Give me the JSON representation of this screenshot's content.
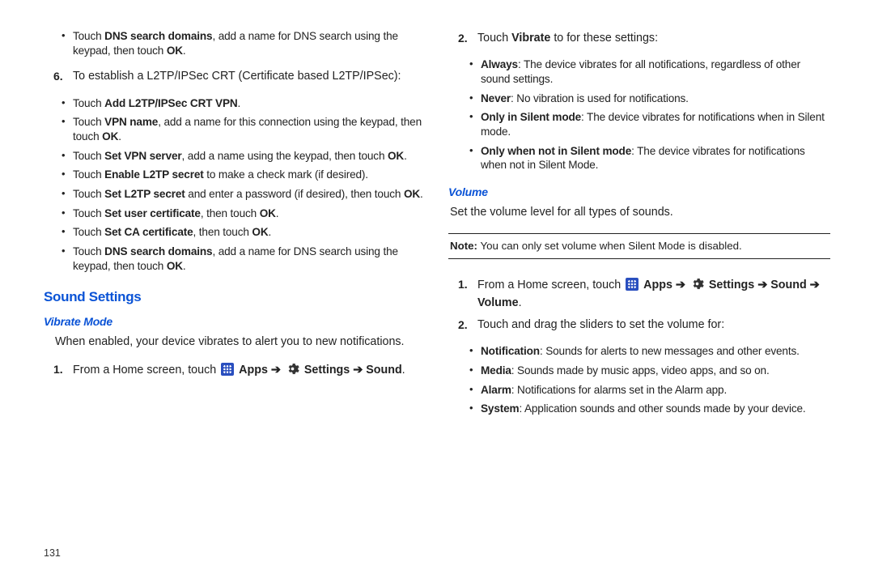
{
  "left": {
    "top_bullets": [
      {
        "parts": [
          "Touch ",
          [
            "b",
            "DNS search domains"
          ],
          ", add a name for DNS search using the keypad, then touch ",
          [
            "b",
            "OK"
          ],
          "."
        ]
      }
    ],
    "step6_label": "6.",
    "step6_text": "To establish a L2TP/IPSec CRT (Certificate based L2TP/IPSec):",
    "step6_bullets": [
      {
        "parts": [
          "Touch ",
          [
            "b",
            "Add L2TP/IPSec CRT VPN"
          ],
          "."
        ]
      },
      {
        "parts": [
          "Touch ",
          [
            "b",
            "VPN name"
          ],
          ", add a name for this connection using the keypad, then touch ",
          [
            "b",
            "OK"
          ],
          "."
        ]
      },
      {
        "parts": [
          "Touch ",
          [
            "b",
            "Set VPN server"
          ],
          ", add a name using the keypad, then touch ",
          [
            "b",
            "OK"
          ],
          "."
        ]
      },
      {
        "parts": [
          "Touch ",
          [
            "b",
            "Enable L2TP secret"
          ],
          " to make a check mark (if desired)."
        ]
      },
      {
        "parts": [
          "Touch ",
          [
            "b",
            "Set L2TP secret"
          ],
          " and enter a password (if desired), then touch ",
          [
            "b",
            "OK"
          ],
          "."
        ]
      },
      {
        "parts": [
          "Touch ",
          [
            "b",
            "Set user certificate"
          ],
          ", then touch ",
          [
            "b",
            "OK"
          ],
          "."
        ]
      },
      {
        "parts": [
          "Touch ",
          [
            "b",
            "Set CA certificate"
          ],
          ", then touch ",
          [
            "b",
            "OK"
          ],
          "."
        ]
      },
      {
        "parts": [
          "Touch ",
          [
            "b",
            "DNS search domains"
          ],
          ", add a name for DNS search using the keypad, then touch ",
          [
            "b",
            "OK"
          ],
          "."
        ]
      }
    ],
    "section_title": "Sound Settings",
    "sub_title": "Vibrate Mode",
    "vibrate_intro": "When enabled, your device vibrates to alert you to new notifications.",
    "step1_label": "1.",
    "step1_parts": [
      "From a Home screen, touch ",
      [
        "icon",
        "apps"
      ],
      " ",
      [
        "b",
        "Apps"
      ],
      " ",
      [
        "arrow",
        "➔"
      ],
      " ",
      [
        "icon",
        "settings"
      ],
      " ",
      [
        "b",
        "Settings"
      ],
      " ",
      [
        "arrow",
        "➔"
      ],
      " ",
      [
        "b",
        "Sound"
      ],
      "."
    ],
    "page_number": "131"
  },
  "right": {
    "step2_label": "2.",
    "step2_parts": [
      "Touch ",
      [
        "b",
        "Vibrate"
      ],
      " to for these settings:"
    ],
    "step2_bullets": [
      {
        "parts": [
          [
            "b",
            "Always"
          ],
          ": The device vibrates for all notifications, regardless of other sound settings."
        ]
      },
      {
        "parts": [
          [
            "b",
            "Never"
          ],
          ": No vibration is used for notifications."
        ]
      },
      {
        "parts": [
          [
            "b",
            "Only in Silent mode"
          ],
          ": The device vibrates for notifications when in Silent mode."
        ]
      },
      {
        "parts": [
          [
            "b",
            "Only when not in Silent mode"
          ],
          ": The device vibrates for notifications when not in Silent Mode."
        ]
      }
    ],
    "volume_title": "Volume",
    "volume_intro": "Set the volume level for all types of sounds.",
    "note_parts": [
      [
        "b",
        "Note:"
      ],
      " You can only set volume when Silent Mode is disabled."
    ],
    "vol_step1_label": "1.",
    "vol_step1_parts": [
      "From a Home screen, touch ",
      [
        "icon",
        "apps"
      ],
      " ",
      [
        "b",
        "Apps"
      ],
      " ",
      [
        "arrow",
        "➔"
      ],
      " ",
      [
        "icon",
        "settings"
      ],
      " ",
      [
        "b",
        "Settings"
      ],
      " ",
      [
        "arrow",
        "➔"
      ],
      " ",
      [
        "b",
        "Sound"
      ],
      " ",
      [
        "arrow",
        "➔"
      ],
      " ",
      [
        "b",
        "Volume"
      ],
      "."
    ],
    "vol_step2_label": "2.",
    "vol_step2_text": "Touch and drag the sliders to set the volume for:",
    "vol_bullets": [
      {
        "parts": [
          [
            "b",
            "Notification"
          ],
          ": Sounds for alerts to new messages and other events."
        ]
      },
      {
        "parts": [
          [
            "b",
            "Media"
          ],
          ": Sounds made by music apps, video apps, and so on."
        ]
      },
      {
        "parts": [
          [
            "b",
            "Alarm"
          ],
          ": Notifications for alarms set in the Alarm app."
        ]
      },
      {
        "parts": [
          [
            "b",
            "System"
          ],
          ": Application sounds and other sounds made by your device."
        ]
      }
    ]
  }
}
